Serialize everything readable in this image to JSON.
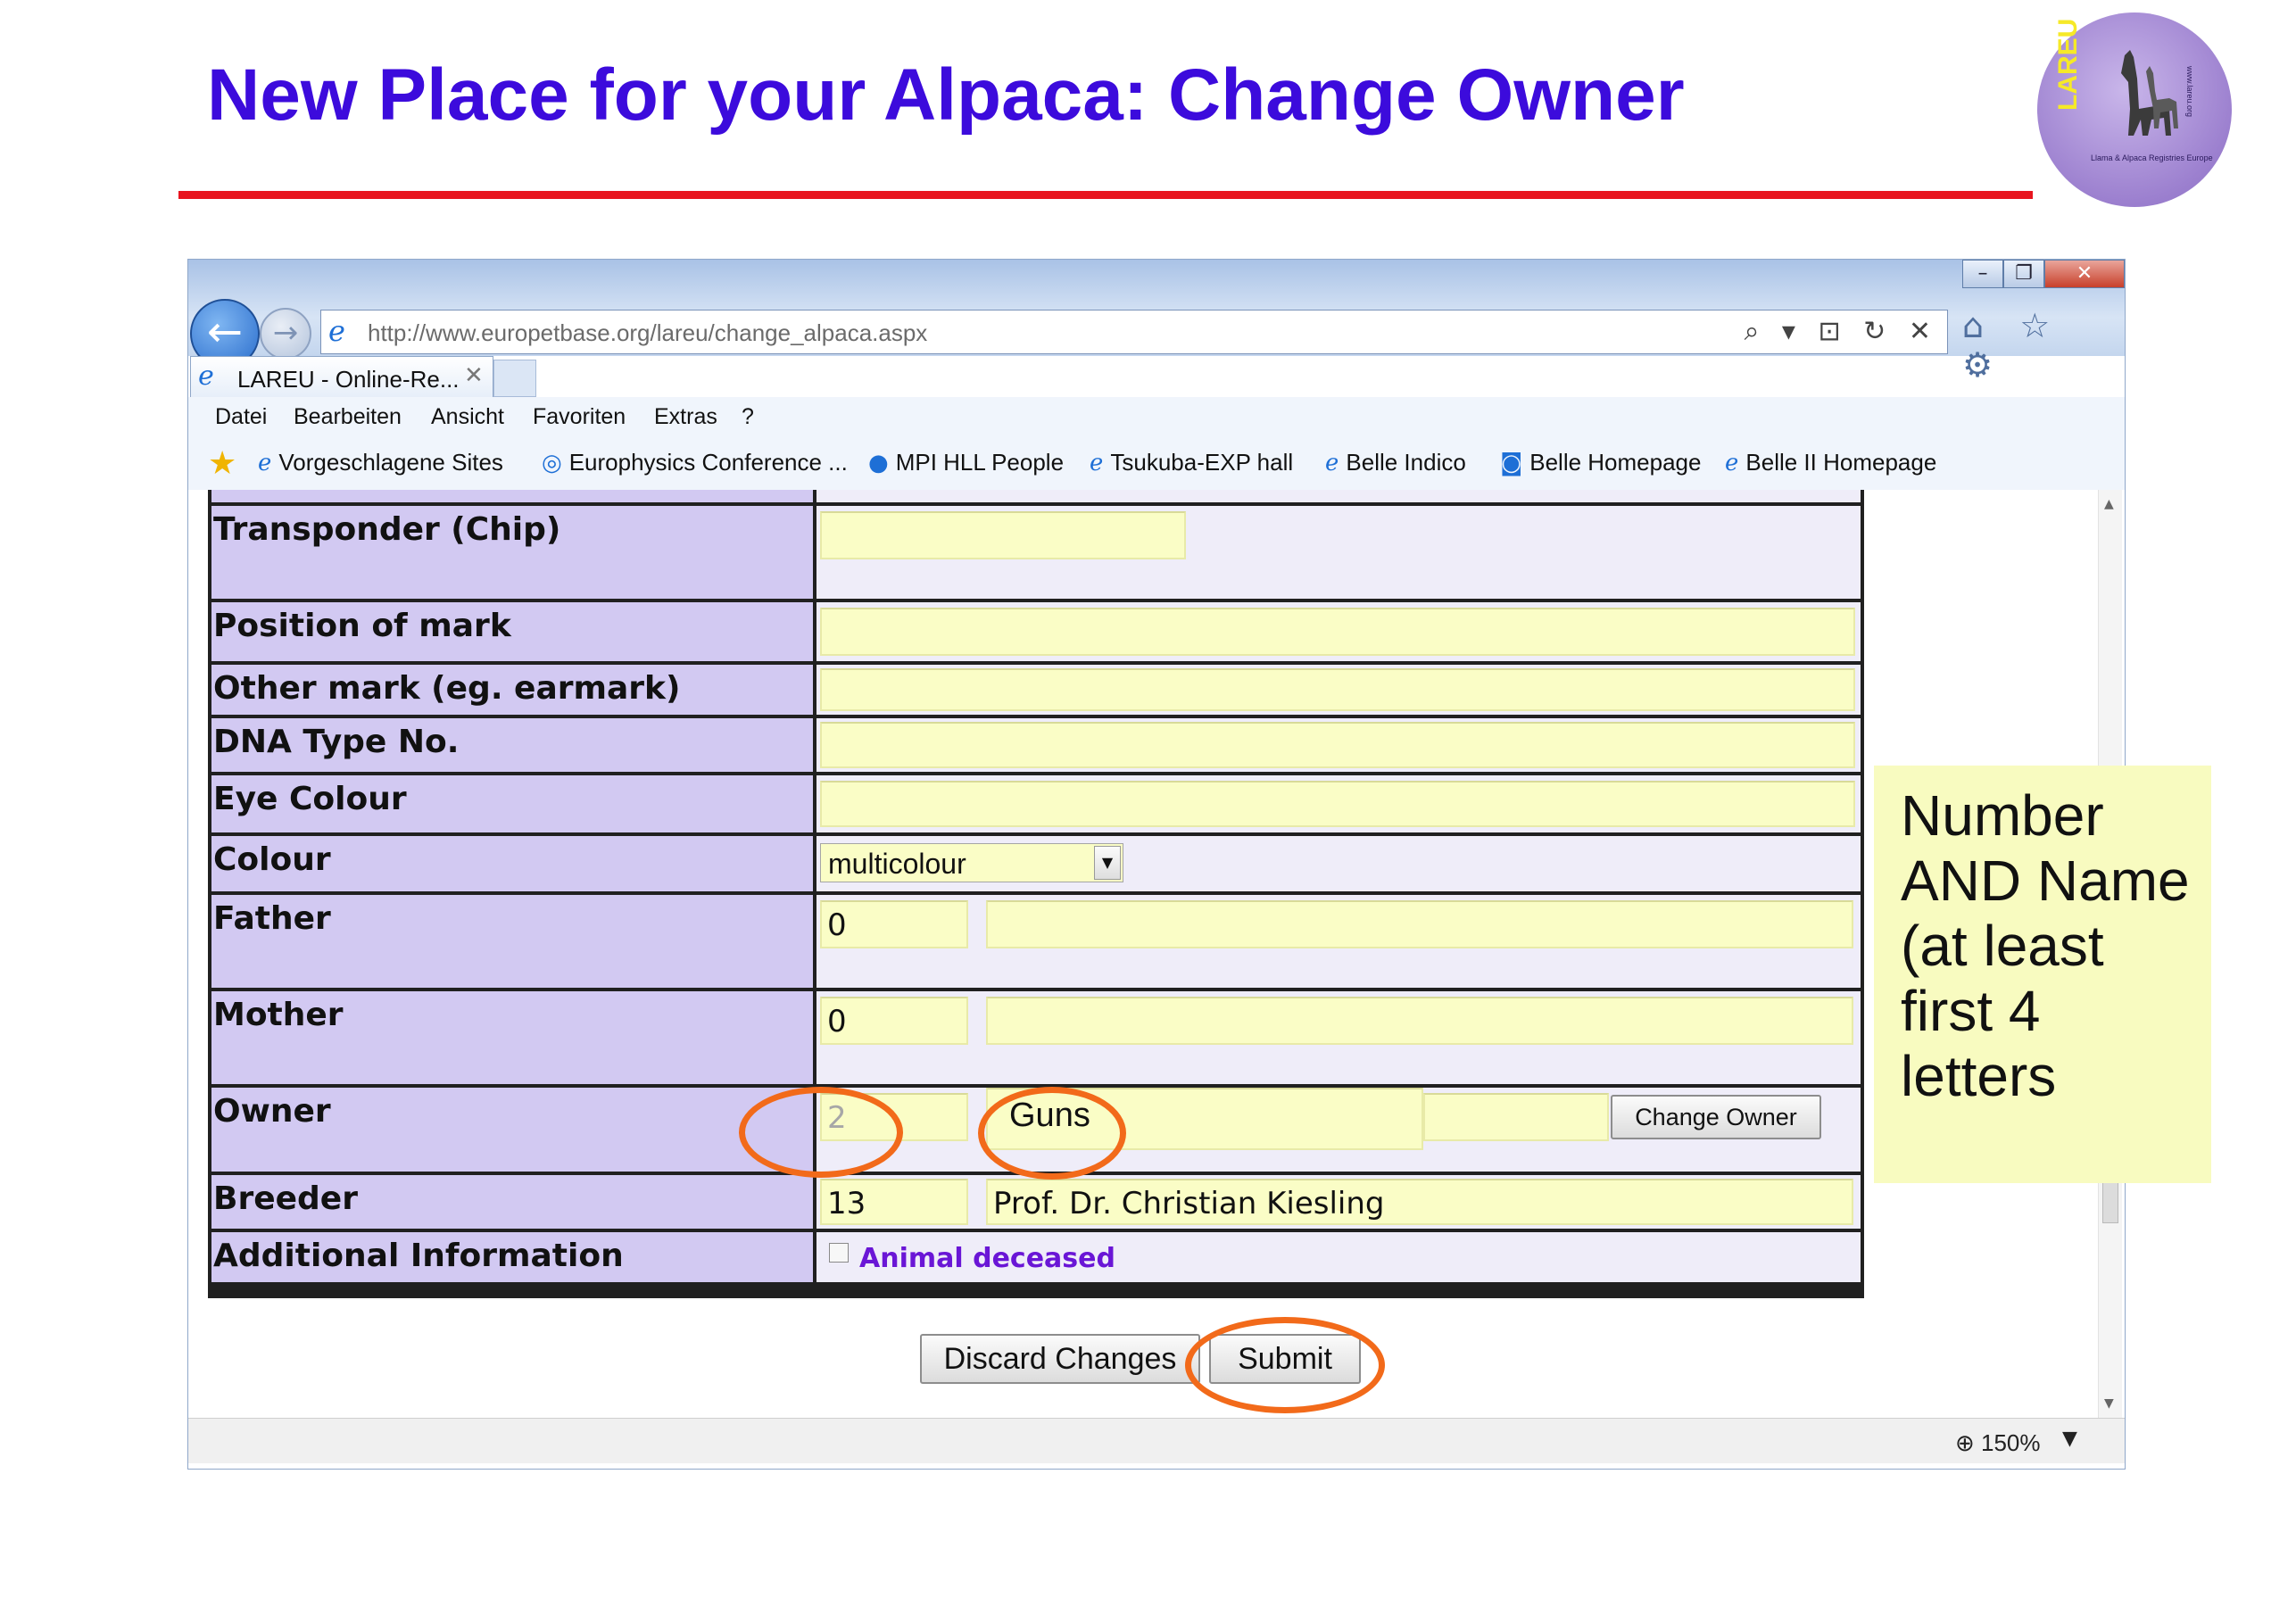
{
  "slide": {
    "title": "New Place for your Alpaca: Change Owner",
    "rule_color": "#e8151f",
    "title_color": "#3c0bdc"
  },
  "logo": {
    "text": "LAREU",
    "subtitle": "Llama & Alpaca Registries Europe",
    "url": "www.lareu.org"
  },
  "browser": {
    "window_buttons": [
      "–",
      "❐",
      "✕"
    ],
    "back_icon": "←",
    "forward_icon": "→",
    "address": "http://www.europetbase.org/lareu/change_alpaca.aspx",
    "address_tools": "⌕ ▾ ⊡ ↻ ✕",
    "right_tools": "⌂ ☆ ⚙",
    "tab_label": "LAREU - Online-Re...",
    "tab_close": "✕",
    "menu": [
      "Datei",
      "Bearbeiten",
      "Ansicht",
      "Favoriten",
      "Extras",
      "?"
    ],
    "favorites": [
      "Vorgeschlagene Sites",
      "Europhysics Conference ...",
      "MPI HLL People",
      "Tsukuba-EXP hall",
      "Belle Indico",
      "Belle Homepage",
      "Belle II Homepage"
    ],
    "zoom": "150%"
  },
  "form": {
    "labels": {
      "transponder": "Transponder (Chip)",
      "position_mark": "Position of mark",
      "other_mark": "Other mark (eg. earmark)",
      "dna": "DNA Type No.",
      "eye": "Eye Colour",
      "colour": "Colour",
      "father": "Father",
      "mother": "Mother",
      "owner": "Owner",
      "breeder": "Breeder",
      "additional": "Additional Information"
    },
    "values": {
      "transponder": "",
      "position_mark": "",
      "other_mark": "",
      "dna": "",
      "eye": "",
      "colour": "multicolour",
      "father_number": "0",
      "father_name": "",
      "mother_number": "0",
      "mother_name": "",
      "owner_number": "2",
      "owner_name": "Guns",
      "breeder_number": "13",
      "breeder_name": "Prof. Dr. Christian Kiesling"
    },
    "change_owner_button": "Change Owner",
    "deceased_label": "Animal deceased",
    "discard_button": "Discard Changes",
    "submit_button": "Submit"
  },
  "annotation": {
    "note": "Number AND Name (at least first 4 letters",
    "ring_color": "#f26a1a"
  }
}
